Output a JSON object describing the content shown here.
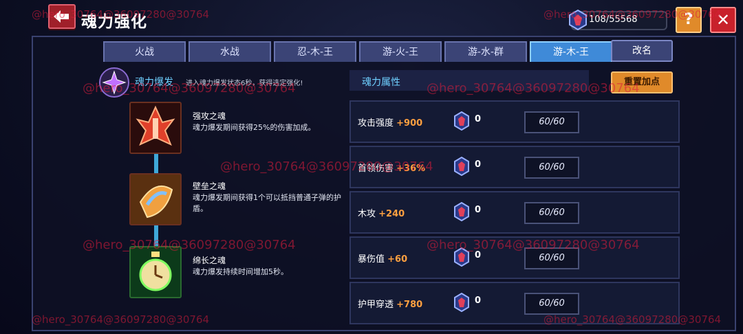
{
  "header": {
    "title": "魂力强化",
    "currency": "108/55568",
    "help_label": "?",
    "close_label": "✕"
  },
  "tabs": [
    {
      "label": "火战",
      "active": false
    },
    {
      "label": "水战",
      "active": false
    },
    {
      "label": "忍-木-王",
      "active": false
    },
    {
      "label": "游-火-王",
      "active": false
    },
    {
      "label": "游-水-群",
      "active": false
    },
    {
      "label": "游-木-王",
      "active": true
    }
  ],
  "rename_label": "改名",
  "burst": {
    "label": "魂力爆发",
    "description": "进入魂力爆发状态6秒，获得选定强化!"
  },
  "skills": [
    {
      "name": "强攻之魂",
      "description": "魂力爆发期间获得25%的伤害加成。"
    },
    {
      "name": "壁垒之魂",
      "description": "魂力爆发期间获得1个可以抵挡普通子弹的护盾。"
    },
    {
      "name": "绵长之魂",
      "description": "魂力爆发持续时间增加5秒。"
    }
  ],
  "attributes": {
    "title": "魂力属性",
    "reset_label": "重置加点",
    "rows": [
      {
        "name": "攻击强度",
        "bonus": "+900",
        "count": "0",
        "cap": "60/60"
      },
      {
        "name": "首领伤害",
        "bonus": "+36%",
        "count": "0",
        "cap": "60/60"
      },
      {
        "name": "木攻",
        "bonus": "+240",
        "count": "0",
        "cap": "60/60"
      },
      {
        "name": "暴伤值",
        "bonus": "+60",
        "count": "0",
        "cap": "60/60"
      },
      {
        "name": "护甲穿透",
        "bonus": "+780",
        "count": "0",
        "cap": "60/60"
      }
    ]
  },
  "watermark": "@hero_30764@36097280@30764",
  "colors": {
    "accent_tab": "#3f8ad8",
    "bonus": "#ffa040",
    "title_blue": "#6fd0ff",
    "close_red": "#c8212b",
    "help_orange": "#e08a2a"
  }
}
